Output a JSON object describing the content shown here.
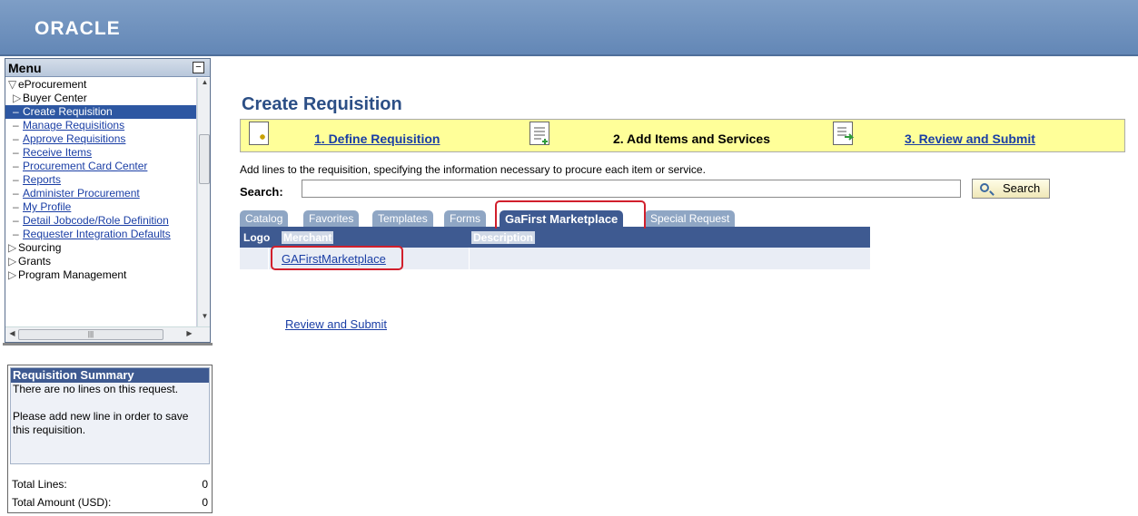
{
  "header": {
    "logo": "ORACLE"
  },
  "menu": {
    "title": "Menu",
    "items": [
      {
        "label": "eProcurement",
        "prefix": "▽",
        "level": 1,
        "link": false
      },
      {
        "label": "Buyer Center",
        "prefix": "▷",
        "level": 2,
        "link": false
      },
      {
        "label": "Create Requisition",
        "prefix": "–",
        "level": 2,
        "link": false,
        "selected": true
      },
      {
        "label": "Manage Requisitions",
        "prefix": "–",
        "level": 2,
        "link": true
      },
      {
        "label": "Approve Requisitions",
        "prefix": "–",
        "level": 2,
        "link": true
      },
      {
        "label": "Receive Items",
        "prefix": "–",
        "level": 2,
        "link": true
      },
      {
        "label": "Procurement Card Center",
        "prefix": "–",
        "level": 2,
        "link": true
      },
      {
        "label": "Reports",
        "prefix": "–",
        "level": 2,
        "link": true
      },
      {
        "label": "Administer Procurement",
        "prefix": "–",
        "level": 2,
        "link": true
      },
      {
        "label": "My Profile",
        "prefix": "–",
        "level": 2,
        "link": true
      },
      {
        "label": "Detail Jobcode/Role Definition",
        "prefix": "–",
        "level": 2,
        "link": true
      },
      {
        "label": "Requester Integration Defaults",
        "prefix": "–",
        "level": 2,
        "link": true
      },
      {
        "label": "Sourcing",
        "prefix": "▷",
        "level": 1,
        "link": false
      },
      {
        "label": "Grants",
        "prefix": "▷",
        "level": 1,
        "link": false
      },
      {
        "label": "Program Management",
        "prefix": "▷",
        "level": 1,
        "link": false
      }
    ]
  },
  "summary": {
    "title": "Requisition Summary",
    "line1": "There are no lines on this request.",
    "line2": "Please add new line in order to save this requisition.",
    "total_lines_label": "Total Lines:",
    "total_lines_value": "0",
    "total_amount_label": "Total Amount (USD):",
    "total_amount_value": "0"
  },
  "main": {
    "title": "Create Requisition",
    "steps": [
      {
        "label": "1. Define Requisition",
        "link": true
      },
      {
        "label": "2. Add Items and Services",
        "link": false
      },
      {
        "label": "3. Review and Submit",
        "link": true
      }
    ],
    "instructions": "Add lines to the requisition, specifying the information necessary to procure each item or service.",
    "search_label": "Search:",
    "search_value": "",
    "search_button": "Search",
    "tabs": [
      "Catalog",
      "Favorites",
      "Templates",
      "Forms",
      "GaFirst Marketplace",
      "Special Request"
    ],
    "active_tab": "GaFirst Marketplace",
    "grid_headers": [
      "Logo",
      "Merchant",
      "Description"
    ],
    "grid_rows": [
      {
        "logo": "",
        "merchant": "GAFirstMarketplace",
        "description": ""
      }
    ],
    "review_link": "Review and Submit"
  },
  "colors": {
    "accent": "#3e5a91",
    "title": "#2c4f86",
    "highlight": "#d11f2c",
    "steps_bg": "#ffff99"
  }
}
